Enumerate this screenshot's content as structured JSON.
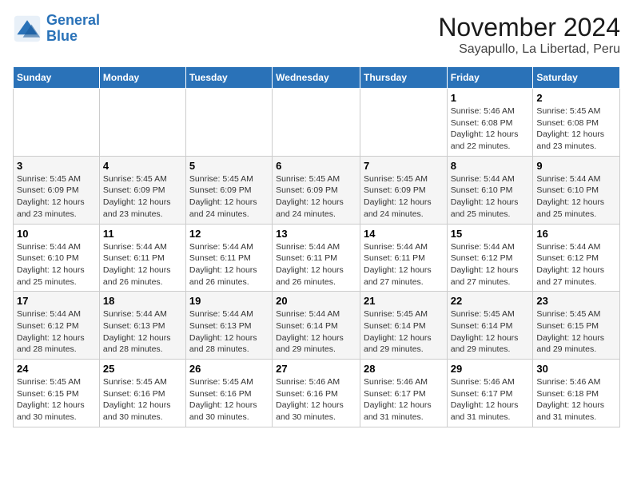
{
  "header": {
    "logo_line1": "General",
    "logo_line2": "Blue",
    "month": "November 2024",
    "location": "Sayapullo, La Libertad, Peru"
  },
  "weekdays": [
    "Sunday",
    "Monday",
    "Tuesday",
    "Wednesday",
    "Thursday",
    "Friday",
    "Saturday"
  ],
  "weeks": [
    [
      {
        "day": "",
        "info": ""
      },
      {
        "day": "",
        "info": ""
      },
      {
        "day": "",
        "info": ""
      },
      {
        "day": "",
        "info": ""
      },
      {
        "day": "",
        "info": ""
      },
      {
        "day": "1",
        "info": "Sunrise: 5:46 AM\nSunset: 6:08 PM\nDaylight: 12 hours and 22 minutes."
      },
      {
        "day": "2",
        "info": "Sunrise: 5:45 AM\nSunset: 6:08 PM\nDaylight: 12 hours and 23 minutes."
      }
    ],
    [
      {
        "day": "3",
        "info": "Sunrise: 5:45 AM\nSunset: 6:09 PM\nDaylight: 12 hours and 23 minutes."
      },
      {
        "day": "4",
        "info": "Sunrise: 5:45 AM\nSunset: 6:09 PM\nDaylight: 12 hours and 23 minutes."
      },
      {
        "day": "5",
        "info": "Sunrise: 5:45 AM\nSunset: 6:09 PM\nDaylight: 12 hours and 24 minutes."
      },
      {
        "day": "6",
        "info": "Sunrise: 5:45 AM\nSunset: 6:09 PM\nDaylight: 12 hours and 24 minutes."
      },
      {
        "day": "7",
        "info": "Sunrise: 5:45 AM\nSunset: 6:09 PM\nDaylight: 12 hours and 24 minutes."
      },
      {
        "day": "8",
        "info": "Sunrise: 5:44 AM\nSunset: 6:10 PM\nDaylight: 12 hours and 25 minutes."
      },
      {
        "day": "9",
        "info": "Sunrise: 5:44 AM\nSunset: 6:10 PM\nDaylight: 12 hours and 25 minutes."
      }
    ],
    [
      {
        "day": "10",
        "info": "Sunrise: 5:44 AM\nSunset: 6:10 PM\nDaylight: 12 hours and 25 minutes."
      },
      {
        "day": "11",
        "info": "Sunrise: 5:44 AM\nSunset: 6:11 PM\nDaylight: 12 hours and 26 minutes."
      },
      {
        "day": "12",
        "info": "Sunrise: 5:44 AM\nSunset: 6:11 PM\nDaylight: 12 hours and 26 minutes."
      },
      {
        "day": "13",
        "info": "Sunrise: 5:44 AM\nSunset: 6:11 PM\nDaylight: 12 hours and 26 minutes."
      },
      {
        "day": "14",
        "info": "Sunrise: 5:44 AM\nSunset: 6:11 PM\nDaylight: 12 hours and 27 minutes."
      },
      {
        "day": "15",
        "info": "Sunrise: 5:44 AM\nSunset: 6:12 PM\nDaylight: 12 hours and 27 minutes."
      },
      {
        "day": "16",
        "info": "Sunrise: 5:44 AM\nSunset: 6:12 PM\nDaylight: 12 hours and 27 minutes."
      }
    ],
    [
      {
        "day": "17",
        "info": "Sunrise: 5:44 AM\nSunset: 6:12 PM\nDaylight: 12 hours and 28 minutes."
      },
      {
        "day": "18",
        "info": "Sunrise: 5:44 AM\nSunset: 6:13 PM\nDaylight: 12 hours and 28 minutes."
      },
      {
        "day": "19",
        "info": "Sunrise: 5:44 AM\nSunset: 6:13 PM\nDaylight: 12 hours and 28 minutes."
      },
      {
        "day": "20",
        "info": "Sunrise: 5:44 AM\nSunset: 6:14 PM\nDaylight: 12 hours and 29 minutes."
      },
      {
        "day": "21",
        "info": "Sunrise: 5:45 AM\nSunset: 6:14 PM\nDaylight: 12 hours and 29 minutes."
      },
      {
        "day": "22",
        "info": "Sunrise: 5:45 AM\nSunset: 6:14 PM\nDaylight: 12 hours and 29 minutes."
      },
      {
        "day": "23",
        "info": "Sunrise: 5:45 AM\nSunset: 6:15 PM\nDaylight: 12 hours and 29 minutes."
      }
    ],
    [
      {
        "day": "24",
        "info": "Sunrise: 5:45 AM\nSunset: 6:15 PM\nDaylight: 12 hours and 30 minutes."
      },
      {
        "day": "25",
        "info": "Sunrise: 5:45 AM\nSunset: 6:16 PM\nDaylight: 12 hours and 30 minutes."
      },
      {
        "day": "26",
        "info": "Sunrise: 5:45 AM\nSunset: 6:16 PM\nDaylight: 12 hours and 30 minutes."
      },
      {
        "day": "27",
        "info": "Sunrise: 5:46 AM\nSunset: 6:16 PM\nDaylight: 12 hours and 30 minutes."
      },
      {
        "day": "28",
        "info": "Sunrise: 5:46 AM\nSunset: 6:17 PM\nDaylight: 12 hours and 31 minutes."
      },
      {
        "day": "29",
        "info": "Sunrise: 5:46 AM\nSunset: 6:17 PM\nDaylight: 12 hours and 31 minutes."
      },
      {
        "day": "30",
        "info": "Sunrise: 5:46 AM\nSunset: 6:18 PM\nDaylight: 12 hours and 31 minutes."
      }
    ]
  ]
}
